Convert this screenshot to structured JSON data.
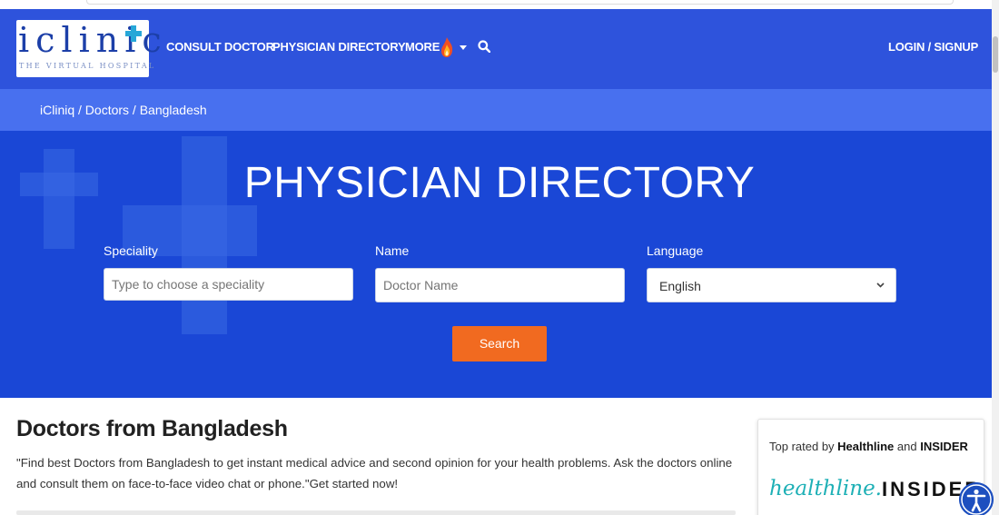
{
  "logo": {
    "brand": "iclinic",
    "tagline": "THE VIRTUAL HOSPITAL"
  },
  "nav": {
    "consult": "CONSULT DOCTOR",
    "physician_directory": "PHYSICIAN DIRECTORY",
    "more": "MORE",
    "login": "LOGIN / SIGNUP"
  },
  "breadcrumb": "iCliniq / Doctors / Bangladesh",
  "hero": {
    "title": "PHYSICIAN DIRECTORY",
    "speciality_label": "Speciality",
    "speciality_placeholder": "Type to choose a speciality",
    "name_label": "Name",
    "name_placeholder": "Doctor Name",
    "language_label": "Language",
    "language_value": "English",
    "search_button": "Search"
  },
  "content": {
    "title": "Doctors from Bangladesh",
    "description": "\"Find best Doctors from Bangladesh to get instant medical advice and second opinion for your health problems. Ask the doctors online and consult them on face-to-face video chat or phone.\"Get started now!"
  },
  "sidebar_card": {
    "prefix": "Top rated by ",
    "brand1": "Healthline",
    "joiner": " and ",
    "brand2": "INSIDER",
    "logo1": "healthline.",
    "logo2": "INSIDER"
  },
  "icons": [
    "flame-icon",
    "chevron-down-icon",
    "search-icon",
    "accessibility-icon"
  ],
  "colors": {
    "nav_bg": "#2e53dc",
    "breadcrumb_bg": "#4870ef",
    "hero_bg": "#1a47d6",
    "accent": "#f16a20",
    "healthline": "#1eb0b6"
  }
}
